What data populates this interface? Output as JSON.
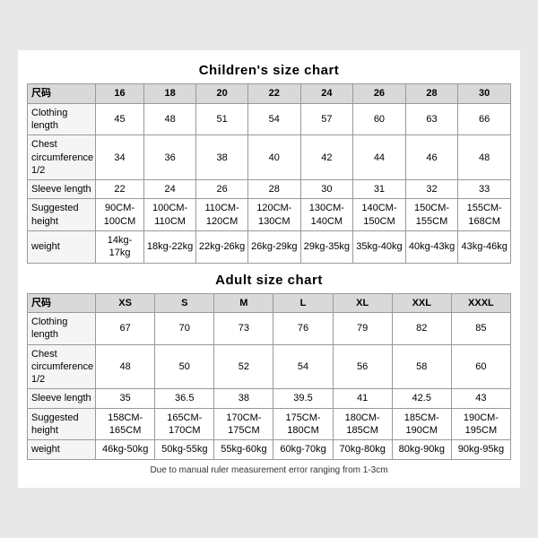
{
  "children_chart": {
    "title": "Children's size chart",
    "headers": [
      "尺码",
      "16",
      "18",
      "20",
      "22",
      "24",
      "26",
      "28",
      "30"
    ],
    "rows": [
      {
        "label": "Clothing length",
        "values": [
          "45",
          "48",
          "51",
          "54",
          "57",
          "60",
          "63",
          "66"
        ]
      },
      {
        "label": "Chest circumference 1/2",
        "values": [
          "34",
          "36",
          "38",
          "40",
          "42",
          "44",
          "46",
          "48"
        ]
      },
      {
        "label": "Sleeve length",
        "values": [
          "22",
          "24",
          "26",
          "28",
          "30",
          "31",
          "32",
          "33"
        ]
      },
      {
        "label": "Suggested height",
        "values": [
          "90CM-100CM",
          "100CM-110CM",
          "110CM-120CM",
          "120CM-130CM",
          "130CM-140CM",
          "140CM-150CM",
          "150CM-155CM",
          "155CM-168CM"
        ]
      },
      {
        "label": "weight",
        "values": [
          "14kg-17kg",
          "18kg-22kg",
          "22kg-26kg",
          "26kg-29kg",
          "29kg-35kg",
          "35kg-40kg",
          "40kg-43kg",
          "43kg-46kg"
        ]
      }
    ]
  },
  "adult_chart": {
    "title": "Adult size chart",
    "headers": [
      "尺码",
      "XS",
      "S",
      "M",
      "L",
      "XL",
      "XXL",
      "XXXL"
    ],
    "rows": [
      {
        "label": "Clothing length",
        "values": [
          "67",
          "70",
          "73",
          "76",
          "79",
          "82",
          "85"
        ]
      },
      {
        "label": "Chest circumference 1/2",
        "values": [
          "48",
          "50",
          "52",
          "54",
          "56",
          "58",
          "60"
        ]
      },
      {
        "label": "Sleeve length",
        "values": [
          "35",
          "36.5",
          "38",
          "39.5",
          "41",
          "42.5",
          "43"
        ]
      },
      {
        "label": "Suggested height",
        "values": [
          "158CM-165CM",
          "165CM-170CM",
          "170CM-175CM",
          "175CM-180CM",
          "180CM-185CM",
          "185CM-190CM",
          "190CM-195CM"
        ]
      },
      {
        "label": "weight",
        "values": [
          "46kg-50kg",
          "50kg-55kg",
          "55kg-60kg",
          "60kg-70kg",
          "70kg-80kg",
          "80kg-90kg",
          "90kg-95kg"
        ]
      }
    ]
  },
  "note": "Due to manual ruler measurement error ranging from 1-3cm"
}
